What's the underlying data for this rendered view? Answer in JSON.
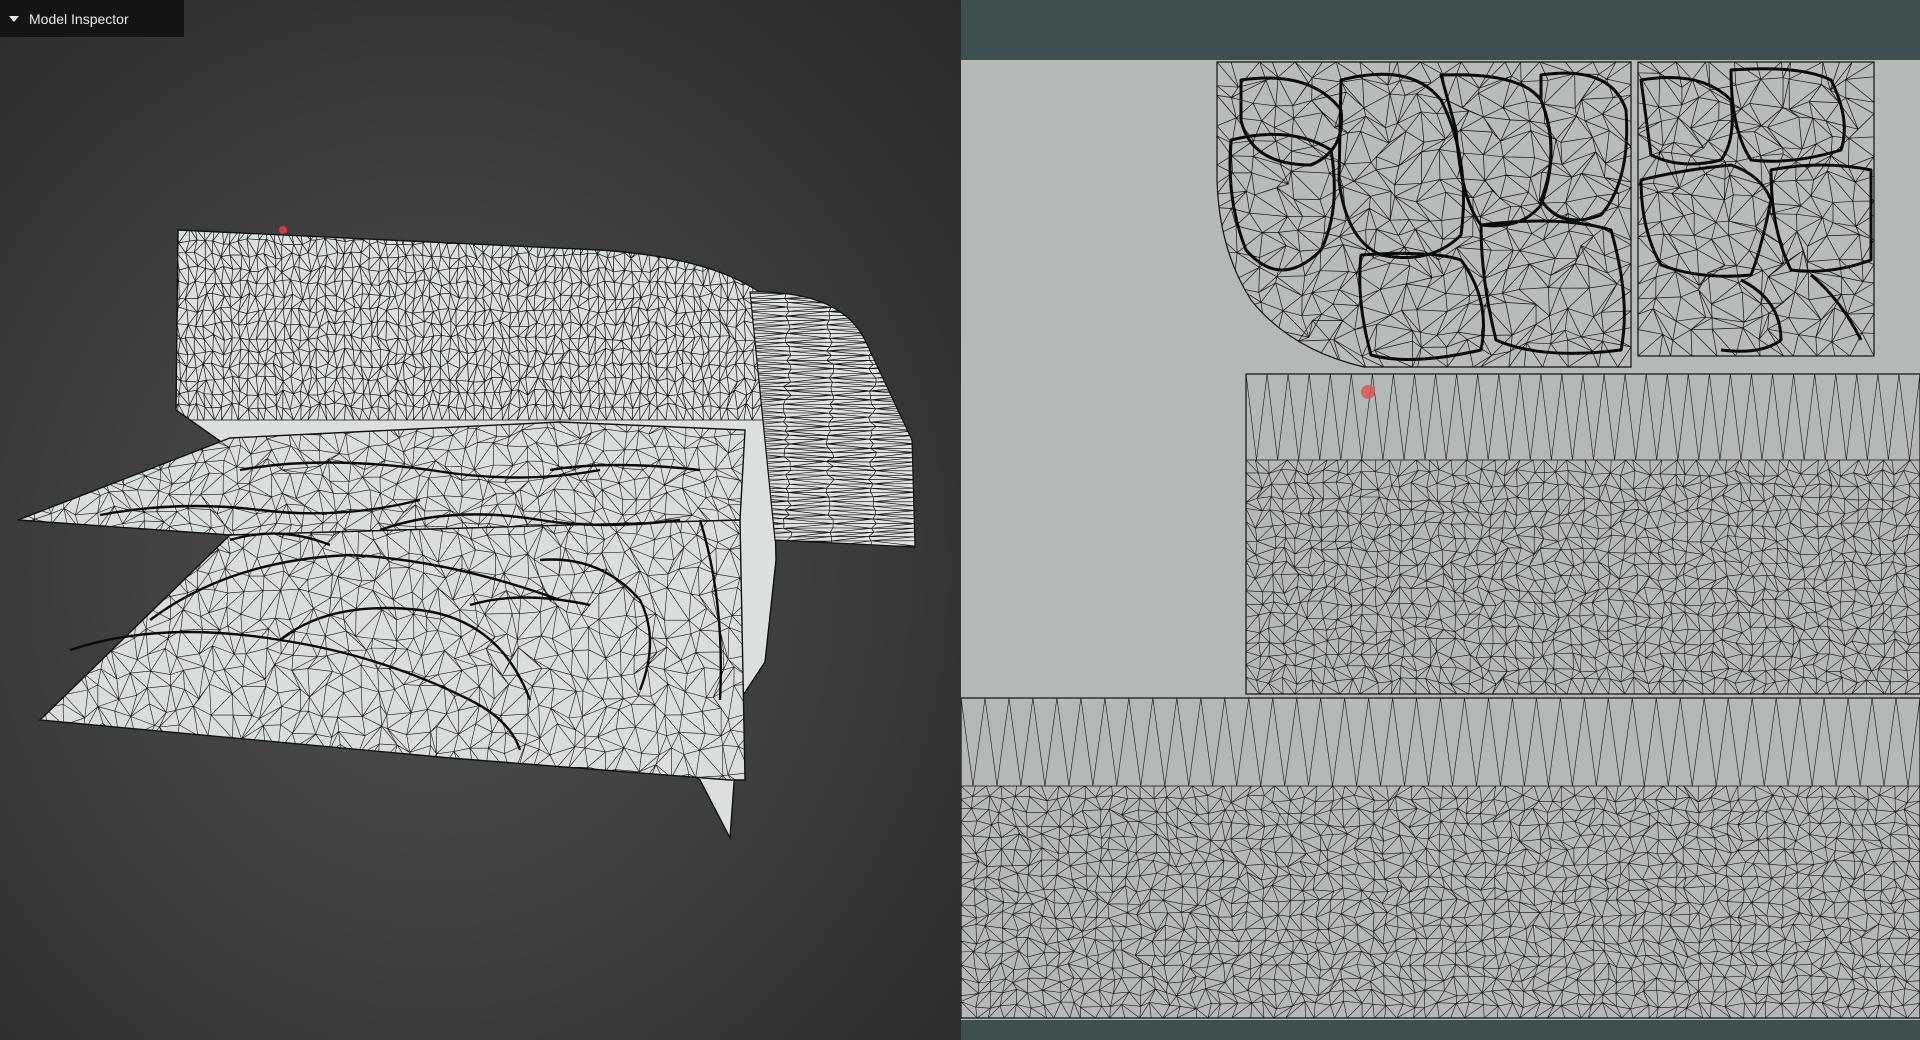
{
  "panel": {
    "title": "Model Inspector",
    "toggle_icon": "caret-down-icon"
  },
  "colors": {
    "viewport_background": "#3a3a3a",
    "mesh_fill": "#d9dcdd",
    "wire": "#111111",
    "uv_canvas": "#b5b8b9",
    "uv_frame": "#3f4f50",
    "marker": "#d9534f"
  }
}
